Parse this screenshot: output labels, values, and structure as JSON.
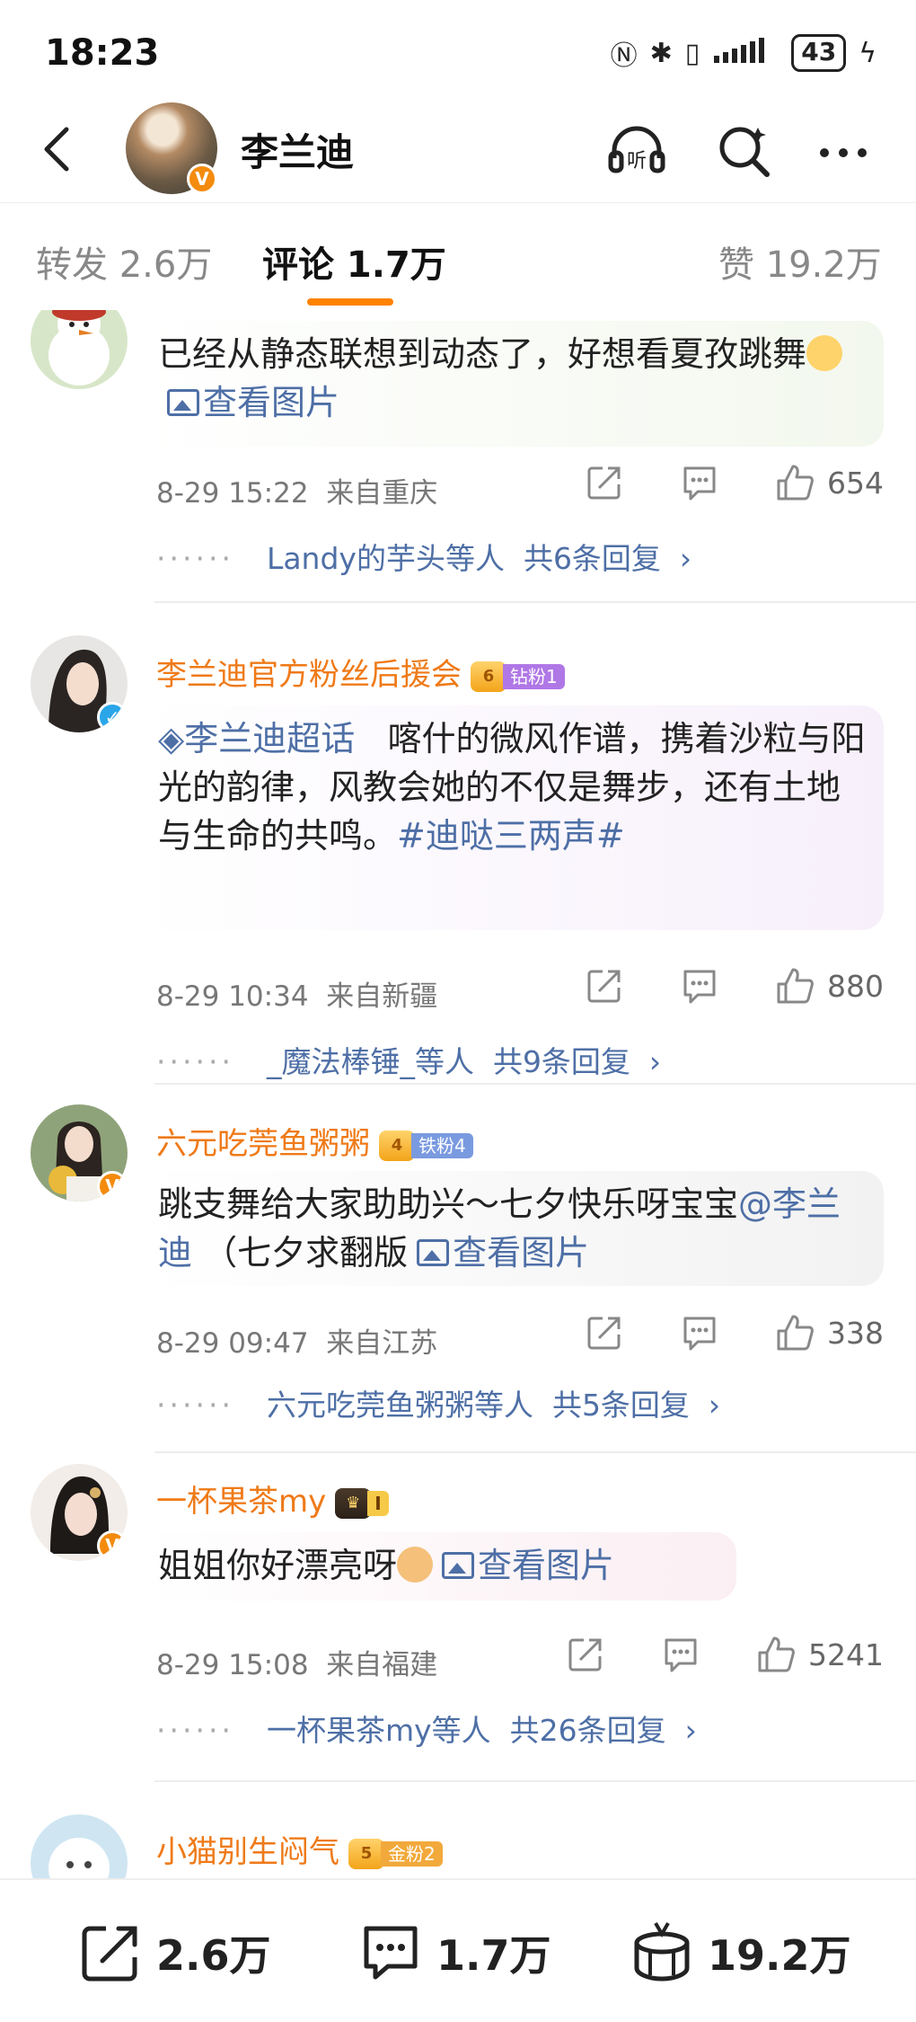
{
  "status_bar": {
    "time": "18:23",
    "battery": "43"
  },
  "header": {
    "title": "李兰迪"
  },
  "tabs": [
    {
      "label": "转发 2.6万"
    },
    {
      "label": "评论 1.7万"
    },
    {
      "label": "赞 19.2万"
    }
  ],
  "comments": [
    {
      "name": "",
      "text": "已经从静态联想到动态了，好想看夏孜跳舞",
      "image_link": "查看图片",
      "time": "8-29 15:22",
      "location": "来自重庆",
      "likes": "654",
      "reply_users": "Landy的芋头等人",
      "reply_count": "共6条回复"
    },
    {
      "name": "李兰迪官方粉丝后援会",
      "fan_badge": "钻粉1",
      "topic": "李兰迪超话",
      "text": "喀什的微风作谱，携着沙粒与阳光的韵律，风教会她的不仅是舞步，还有土地与生命的共鸣。",
      "hashtag": "#迪哒三两声#",
      "time": "8-29 10:34",
      "location": "来自新疆",
      "likes": "880",
      "reply_users": "_魔法棒锤_等人",
      "reply_count": "共9条回复"
    },
    {
      "name": "六元吃莞鱼粥粥",
      "fan_badge": "铁粉4",
      "text": "跳支舞给大家助助兴～七夕快乐呀宝宝",
      "mention": "@李兰迪",
      "text2": "（七夕求翻版",
      "image_link": "查看图片",
      "time": "8-29 09:47",
      "location": "来自江苏",
      "likes": "338",
      "reply_users": "六元吃莞鱼粥粥等人",
      "reply_count": "共5条回复"
    },
    {
      "name": "一杯果茶my",
      "fan_badge": "I",
      "text": "姐姐你好漂亮呀",
      "image_link": "查看图片",
      "time": "8-29 15:08",
      "location": "来自福建",
      "likes": "5241",
      "reply_users": "一杯果茶my等人",
      "reply_count": "共26条回复"
    },
    {
      "name": "小猫别生闷气",
      "fan_badge": "金粉2"
    }
  ],
  "bottom_bar": {
    "repost": "2.6万",
    "comment": "1.7万",
    "like": "19.2万"
  },
  "colors": {
    "accent": "#ff8200",
    "name": "#ef7a18",
    "link": "#4e6fa6"
  }
}
